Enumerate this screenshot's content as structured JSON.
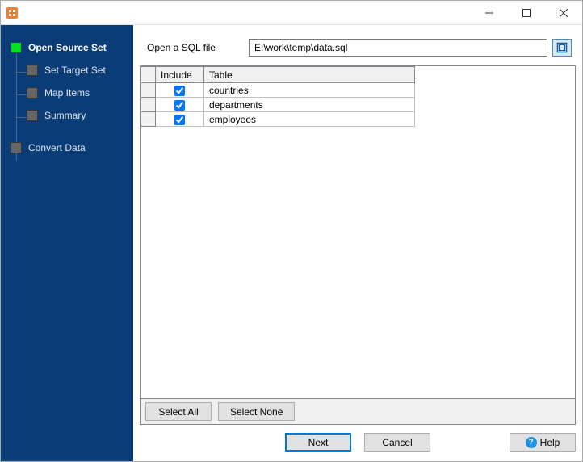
{
  "window": {
    "title": ""
  },
  "sidebar": {
    "items": [
      {
        "label": "Open Source Set",
        "active": true,
        "level": 0
      },
      {
        "label": "Set Target Set",
        "active": false,
        "level": 1
      },
      {
        "label": "Map Items",
        "active": false,
        "level": 1
      },
      {
        "label": "Summary",
        "active": false,
        "level": 1
      },
      {
        "label": "Convert Data",
        "active": false,
        "level": 0
      }
    ]
  },
  "file_picker": {
    "label": "Open a SQL file",
    "value": "E:\\work\\temp\\data.sql"
  },
  "grid": {
    "headers": {
      "include": "Include",
      "table": "Table"
    },
    "rows": [
      {
        "include": true,
        "table": "countries"
      },
      {
        "include": true,
        "table": "departments"
      },
      {
        "include": true,
        "table": "employees"
      }
    ]
  },
  "buttons": {
    "select_all": "Select All",
    "select_none": "Select None",
    "next": "Next",
    "cancel": "Cancel",
    "help": "Help"
  }
}
